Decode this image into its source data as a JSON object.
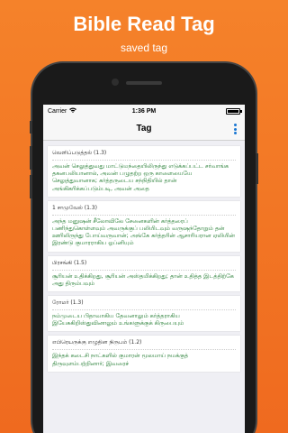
{
  "promo": {
    "title": "Bible Read Tag",
    "subtitle": "saved tag"
  },
  "status_bar": {
    "carrier": "Carrier",
    "wifi_icon": "wifi-icon",
    "time": "1:36 PM",
    "battery_level": 1.0
  },
  "nav": {
    "title": "Tag",
    "menu_icon": "more-vertical-icon"
  },
  "colors": {
    "accent": "#1976d2",
    "verse_text": "#1f7a2e",
    "promo_bg": "#f5822a"
  },
  "tags": [
    {
      "ref": "வெளிப்படுத்தல் (1.3)",
      "verse": "அவன் செலுத்துவது மாட்டுமந்தையிலிருந்து எடுக்கப்பட்ட சர்வாங்க தகனபலியானால், அவன் பழுதற்ற ஒரு காளையையே செலுத்துவானாக; கர்த்தருடைய சந்நிதியில் தான் அங்கிகரிக்கப்படும்படி, அவன் அதை"
    },
    {
      "ref": "1 சாமுவேல் (1.3)",
      "verse": "அந்த மனுஷன் சீலோவிலே சேனைகளின் கர்த்தரைப் பணிந்துகொள்ளவும் அவருக்குப் பலியிடவும் வருஷந்தோறும் தன் ஊரிலிருந்து போய்வருவான்; அங்கே கர்த்தரின் ஆசாரியரான ஏலியின் இரண்டு குமாரராகிய ஓப்னியும்"
    },
    {
      "ref": "பிரசங்கி (1.5)",
      "verse": "சூரியன் உதிக்கிறது, சூரியன் அஸ்தமிக்கிறது; தான் உதித்த இடத்திற்கே அது திரும்பவும்"
    },
    {
      "ref": "ரோமர் (1.3)",
      "verse": "நம்முடைய பிதாவாகிய தேவனாலும் கர்த்தராகிய இயேசுகிறிஸ்துவினாலும் உங்களுக்குக் கிருபையும்"
    },
    {
      "ref": "எபிரெயருக்கு எழுதின நிருபம் (1.2)",
      "verse": "இந்தக் கடைசி நாட்களில் குமாரன் மூலமாய் நமக்குத் திருவுளம்பற்றினார்; இவரைச்"
    }
  ],
  "tab_bar": {
    "icons": [
      "book-icon",
      "tag-icon",
      "info-icon"
    ]
  }
}
